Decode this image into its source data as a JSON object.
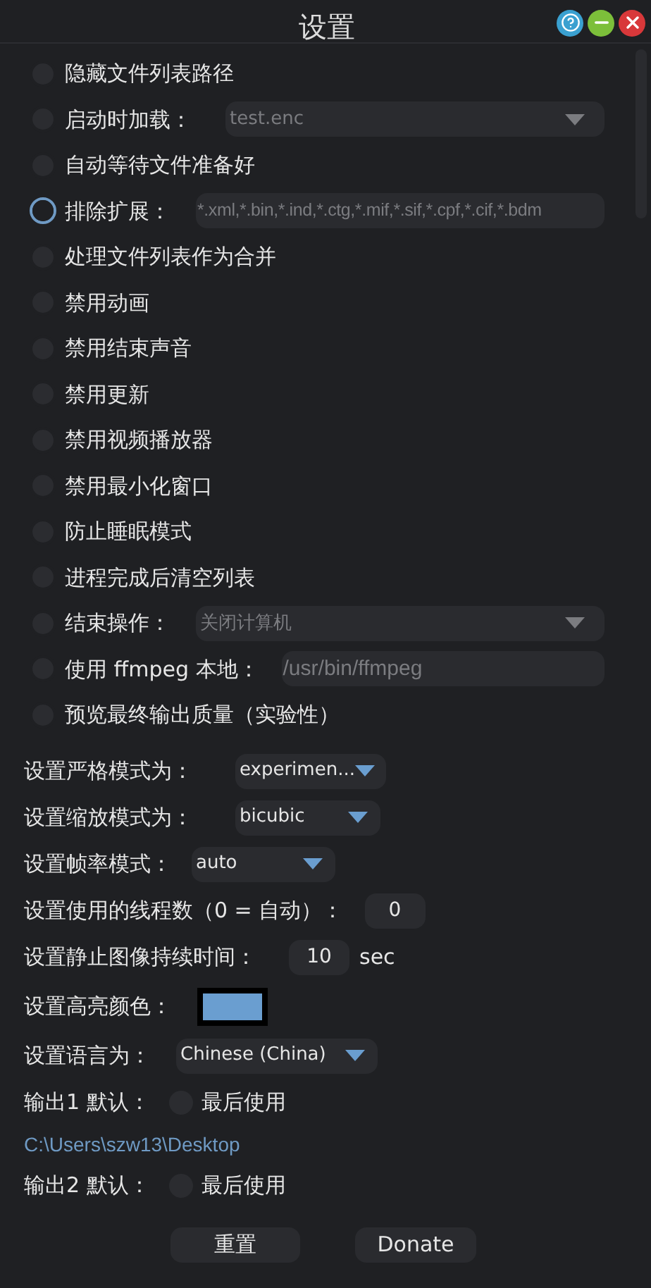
{
  "window": {
    "title": "设置"
  },
  "options": [
    {
      "kind": "check",
      "label": "隐藏文件列表路径",
      "checked": false,
      "focused": false
    },
    {
      "kind": "combo",
      "label": "启动时加载：",
      "checked": false,
      "focused": false,
      "value": "test.enc",
      "disabled": true
    },
    {
      "kind": "check",
      "label": "自动等待文件准备好",
      "checked": false,
      "focused": false
    },
    {
      "kind": "text",
      "label": "排除扩展：",
      "checked": false,
      "focused": true,
      "value": "*.xml,*.bin,*.ind,*.ctg,*.mif,*.sif,*.cpf,*.cif,*.bdm",
      "disabled": true
    },
    {
      "kind": "check",
      "label": "处理文件列表作为合并",
      "checked": false,
      "focused": false
    },
    {
      "kind": "check",
      "label": "禁用动画",
      "checked": false,
      "focused": false
    },
    {
      "kind": "check",
      "label": "禁用结束声音",
      "checked": false,
      "focused": false
    },
    {
      "kind": "check",
      "label": "禁用更新",
      "checked": false,
      "focused": false
    },
    {
      "kind": "check",
      "label": "禁用视频播放器",
      "checked": false,
      "focused": false
    },
    {
      "kind": "check",
      "label": "禁用最小化窗口",
      "checked": false,
      "focused": false
    },
    {
      "kind": "check",
      "label": "防止睡眠模式",
      "checked": false,
      "focused": false
    },
    {
      "kind": "check",
      "label": "进程完成后清空列表",
      "checked": false,
      "focused": false
    },
    {
      "kind": "combo",
      "label": "结束操作：",
      "checked": false,
      "focused": false,
      "value": "关闭计算机",
      "disabled": true
    },
    {
      "kind": "text",
      "label": "使用 ffmpeg 本地：",
      "checked": false,
      "focused": false,
      "value": "/usr/bin/ffmpeg",
      "disabled": true
    },
    {
      "kind": "check",
      "label": "预览最终输出质量（实验性）",
      "checked": false,
      "focused": false
    }
  ],
  "settings": [
    {
      "kind": "select",
      "label": "设置严格模式为：",
      "value": "experimen..."
    },
    {
      "kind": "select",
      "label": "设置缩放模式为：",
      "value": "bicubic"
    },
    {
      "kind": "select",
      "label": "设置帧率模式：",
      "value": "auto"
    },
    {
      "kind": "number",
      "label": "设置使用的线程数（0 = 自动）：",
      "value": "0"
    },
    {
      "kind": "number",
      "label": "设置静止图像持续时间：",
      "value": "10",
      "unit": "sec"
    },
    {
      "kind": "color",
      "label": "设置高亮颜色：",
      "color": "#6a9ed0"
    },
    {
      "kind": "select",
      "label": "设置语言为：",
      "value": "Chinese (China)"
    }
  ],
  "outputs": [
    {
      "label": "输出1 默认：",
      "option": "最后使用",
      "checked": false,
      "path": "C:\\Users\\szw13\\Desktop"
    },
    {
      "label": "输出2 默认：",
      "option": "最后使用",
      "checked": false
    }
  ],
  "buttons": [
    "重置",
    "Donate"
  ]
}
